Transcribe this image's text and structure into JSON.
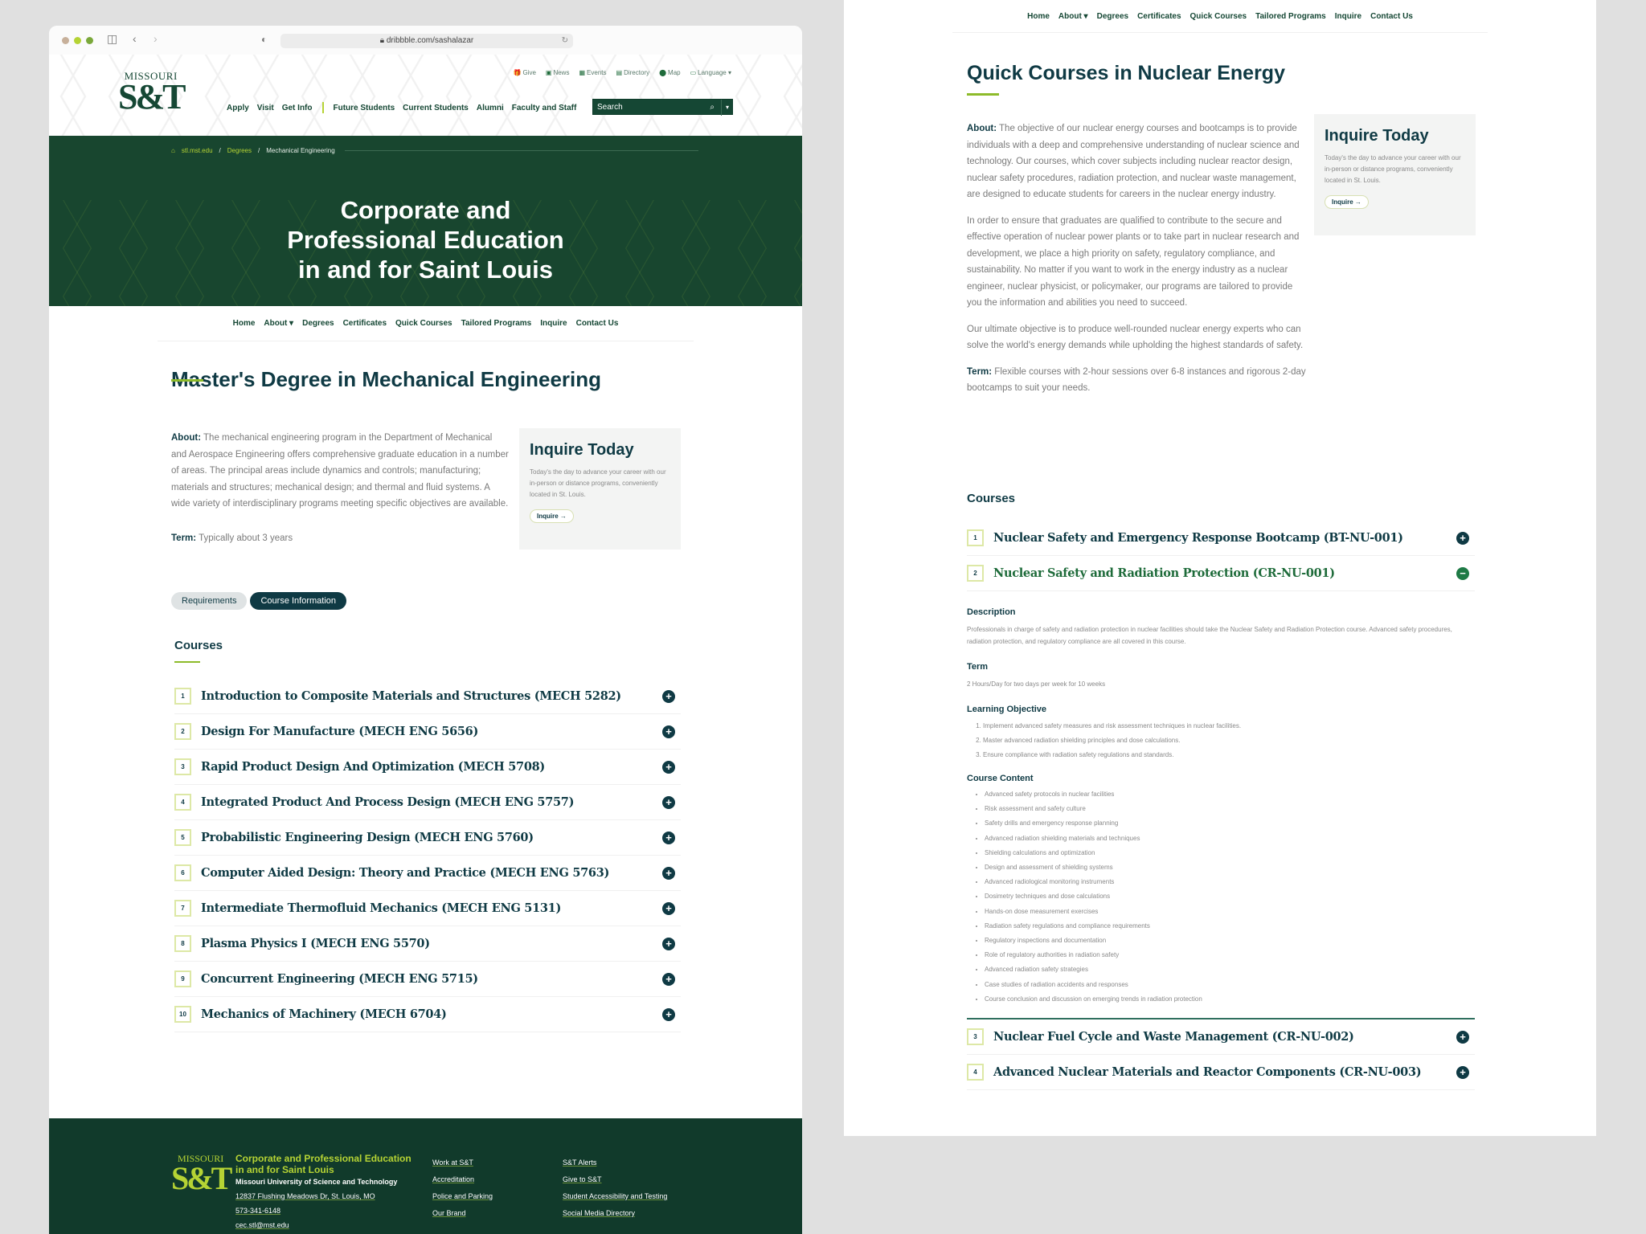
{
  "browser": {
    "url": "dribbble.com/sashalazar",
    "traffic_lights": [
      "#c7b09a",
      "#b5d334",
      "#7aa83a"
    ]
  },
  "header": {
    "logo_top": "MISSOURI",
    "logo_main": "S&T",
    "utility_nav": [
      {
        "icon": "gift-icon",
        "glyph": "🎁",
        "label": "Give"
      },
      {
        "icon": "news-icon",
        "glyph": "▣",
        "label": "News"
      },
      {
        "icon": "calendar-icon",
        "glyph": "▦",
        "label": "Events"
      },
      {
        "icon": "directory-icon",
        "glyph": "▤",
        "label": "Directory"
      },
      {
        "icon": "map-pin-icon",
        "glyph": "⬤",
        "label": "Map"
      },
      {
        "icon": "language-icon",
        "glyph": "▭",
        "label": "Language ▾"
      }
    ],
    "main_nav_left": [
      "Apply",
      "Visit",
      "Get Info"
    ],
    "main_nav_right": [
      "Future Students",
      "Current Students",
      "Alumni",
      "Faculty and Staff"
    ],
    "search_placeholder": "Search"
  },
  "breadcrumb": [
    "stl.mst.edu",
    "Degrees",
    "Mechanical Engineering"
  ],
  "hero_title_lines": [
    "Corporate and",
    "Professional Education",
    "in and for Saint Louis"
  ],
  "sub_nav": [
    "Home",
    "About ▾",
    "Degrees",
    "Certificates",
    "Quick Courses",
    "Tailored Programs",
    "Inquire",
    "Contact Us"
  ],
  "left_page": {
    "title": "Master's Degree in Mechanical Engineering",
    "about_label": "About:",
    "about_text": " The mechanical engineering program in the Department of Mechanical and Aerospace Engineering offers comprehensive graduate education in a number of areas. The principal areas include dynamics and controls; manufacturing; materials and structures; mechanical design; and thermal and fluid systems. A wide variety of interdisciplinary programs meeting specific objectives are available.",
    "term_label": "Term:",
    "term_text": " Typically about 3 years",
    "tabs": [
      {
        "label": "Requirements",
        "active": false
      },
      {
        "label": "Course Information",
        "active": true
      }
    ],
    "courses_heading": "Courses",
    "courses": [
      {
        "n": "1",
        "title": "Introduction to Composite Materials and Structures (MECH 5282)"
      },
      {
        "n": "2",
        "title": "Design For Manufacture (MECH ENG 5656)"
      },
      {
        "n": "3",
        "title": "Rapid Product Design And Optimization (MECH 5708)"
      },
      {
        "n": "4",
        "title": "Integrated Product And Process Design (MECH ENG 5757)"
      },
      {
        "n": "5",
        "title": "Probabilistic Engineering Design (MECH ENG 5760)"
      },
      {
        "n": "6",
        "title": "Computer Aided Design: Theory and Practice (MECH ENG 5763)"
      },
      {
        "n": "7",
        "title": "Intermediate Thermofluid Mechanics (MECH ENG 5131)"
      },
      {
        "n": "8",
        "title": "Plasma Physics I (MECH ENG 5570)"
      },
      {
        "n": "9",
        "title": "Concurrent Engineering (MECH ENG 5715)"
      },
      {
        "n": "10",
        "title": "Mechanics of Machinery (MECH 6704)"
      }
    ]
  },
  "inquire": {
    "title": "Inquire Today",
    "text": "Today's the day to advance your career with our in-person or distance programs, conveniently located in St. Louis.",
    "button": "Inquire →"
  },
  "footer": {
    "logo_top": "MISSOURI",
    "logo_main": "S&T",
    "title": "Corporate and Professional Education in and for Saint Louis",
    "university": "Missouri University of Science and Technology",
    "address": "12837 Flushing Meadows Dr, St. Louis, MO",
    "phone": "573-341-6148",
    "email": "cec.stl@mst.edu",
    "links_col1": [
      "Work at S&T",
      "Accreditation",
      "Police and Parking",
      "Our Brand"
    ],
    "links_col2": [
      "S&T Alerts",
      "Give to S&T",
      "Student Accessibility and Testing",
      "Social Media Directory"
    ]
  },
  "right_page": {
    "title": "Quick Courses in Nuclear Energy",
    "about_label": "About:",
    "about_text": " The objective of our nuclear energy courses and bootcamps is to provide individuals with a deep and comprehensive understanding of nuclear science and technology. Our courses, which cover subjects including nuclear reactor design, nuclear safety procedures, radiation protection, and nuclear waste management, are designed to educate students for careers in the nuclear energy industry.",
    "para2": "In order to ensure that graduates are qualified to contribute to the secure and effective operation of nuclear power plants or to take part in nuclear research and development, we place a high priority on safety, regulatory compliance, and sustainability. No matter if you want to work in the energy industry as a nuclear engineer, nuclear physicist, or policymaker, our programs are tailored to provide you the information and abilities you need to succeed.",
    "para3": "Our ultimate objective is to produce well-rounded nuclear energy experts who can solve the world's energy demands while upholding the highest standards of safety.",
    "term_label": "Term:",
    "term_text": " Flexible courses with 2-hour sessions over 6-8 instances and rigorous 2-day bootcamps to suit your needs.",
    "courses_heading": "Courses",
    "courses": [
      {
        "n": "1",
        "title": "Nuclear Safety and Emergency Response Bootcamp (BT-NU-001)",
        "expanded": false
      },
      {
        "n": "2",
        "title": "Nuclear Safety and Radiation Protection (CR-NU-001)",
        "expanded": true
      },
      {
        "n": "3",
        "title": "Nuclear Fuel Cycle and Waste Management (CR-NU-002)",
        "expanded": false
      },
      {
        "n": "4",
        "title": "Advanced Nuclear Materials and Reactor Components (CR-NU-003)",
        "expanded": false
      }
    ],
    "detail": {
      "description_heading": "Description",
      "description": "Professionals in charge of safety and radiation protection in nuclear facilities should take the Nuclear Safety and Radiation Protection course. Advanced safety procedures, radiation protection, and regulatory compliance are all covered in this course.",
      "term_heading": "Term",
      "term": "2 Hours/Day for two days per week for 10 weeks",
      "objective_heading": "Learning Objective",
      "objectives": [
        "Implement advanced safety measures and risk assessment techniques in nuclear facilities.",
        "Master advanced radiation shielding principles and dose calculations.",
        "Ensure compliance with radiation safety regulations and standards."
      ],
      "content_heading": "Course Content",
      "content": [
        "Advanced safety protocols in nuclear facilities",
        "Risk assessment and safety culture",
        "Safety drills and emergency response planning",
        "Advanced radiation shielding materials and techniques",
        "Shielding calculations and optimization",
        "Design and assessment of shielding systems",
        "Advanced radiological monitoring instruments",
        "Dosimetry techniques and dose calculations",
        "Hands-on dose measurement exercises",
        "Radiation safety regulations and compliance requirements",
        "Regulatory inspections and documentation",
        "Role of regulatory authorities in radiation safety",
        "Advanced radiation safety strategies",
        "Case studies of radiation accidents and responses",
        "Course conclusion and discussion on emerging trends in radiation protection"
      ]
    }
  }
}
